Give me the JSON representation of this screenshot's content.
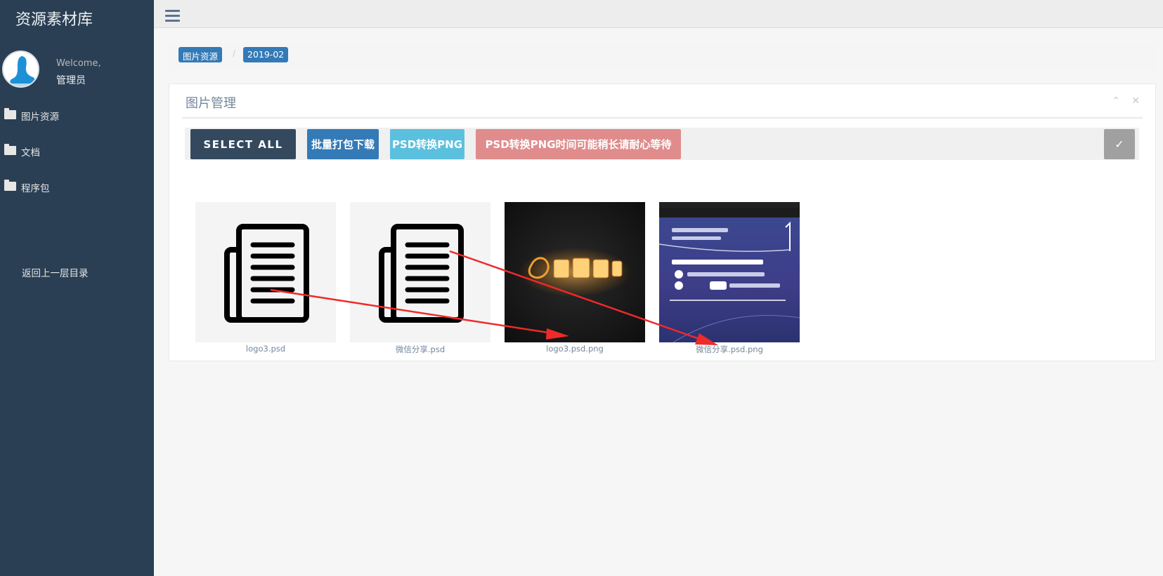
{
  "sidebar": {
    "brand": "资源素材库",
    "welcome": "Welcome,",
    "user": "管理员",
    "menu": [
      {
        "label": "图片资源",
        "icon": "folder-icon"
      },
      {
        "label": "文档",
        "icon": "folder-icon"
      },
      {
        "label": "程序包",
        "icon": "folder-icon"
      }
    ],
    "back": "返回上一层目录"
  },
  "breadcrumb": [
    "图片资源",
    "2019-02"
  ],
  "breadcrumb_sep": "/",
  "panel": {
    "title": "图片管理",
    "tools": {
      "collapse": "⌃",
      "close": "✕"
    }
  },
  "toolbar": {
    "select_all": "SELECT ALL",
    "pack_download": "批量打包下载",
    "psd_to_png": "PSD转换PNG",
    "wait_notice": "PSD转换PNG时间可能稍长请耐心等待",
    "confirm": "✓"
  },
  "files": [
    {
      "name": "logo3.psd",
      "kind": "document"
    },
    {
      "name": "微信分享.psd",
      "kind": "document"
    },
    {
      "name": "logo3.psd.png",
      "kind": "image"
    },
    {
      "name": "微信分享.psd.png",
      "kind": "image"
    }
  ],
  "colors": {
    "sidebar": "#2a3f54",
    "primary": "#337ab7",
    "info": "#5bc0de",
    "danger": "#e08c8c",
    "dark": "#34495e",
    "annotation_arrow": "#ee2a2a"
  }
}
